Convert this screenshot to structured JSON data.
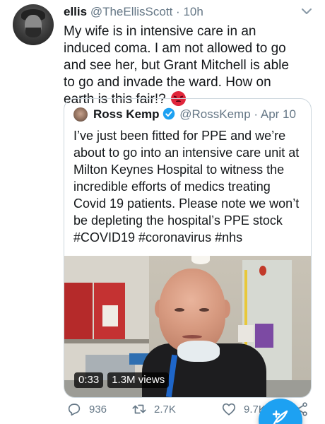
{
  "tweet": {
    "author_name": "ellis",
    "author_handle": "@TheEllisScott",
    "separator": "·",
    "time": "10h",
    "text": "My wife is in intensive care in an induced coma. I am not allowed to go and see her, but Grant Mitchell is able to go and invade the ward. How on earth is this fair!?",
    "emoji": "angry-face-icon"
  },
  "quoted_tweet": {
    "author_name": "Ross Kemp",
    "author_handle": "@RossKemp",
    "separator": "·",
    "time": "Apr 10",
    "verified": true,
    "text": "I’ve just been fitted for PPE and we’re about to go into an intensive care unit at Milton Keynes Hospital to witness the incredible efforts of medics treating Covid 19 patients. Please note we won’t be depleting the hospital’s PPE stock #COVID19 #coronavirus #nhs",
    "video": {
      "duration": "0:33",
      "views": "1.3M views"
    }
  },
  "actions": {
    "replies": "936",
    "retweets": "2.7K",
    "likes": "9.7K"
  },
  "colors": {
    "accent": "#1da1f2",
    "text": "#14171a",
    "secondary": "#657786",
    "border": "#ccd6dd"
  }
}
